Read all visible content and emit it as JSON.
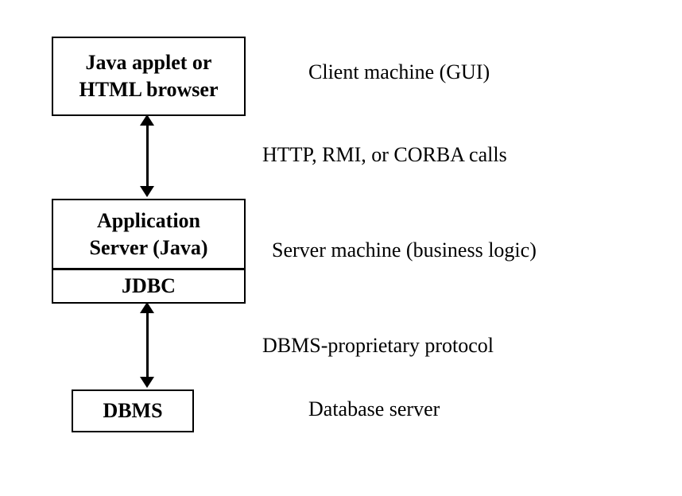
{
  "diagram": {
    "boxes": {
      "client": {
        "line1": "Java applet or",
        "line2": "HTML browser"
      },
      "appserver": {
        "line1": "Application",
        "line2": "Server (Java)",
        "jdbc": "JDBC"
      },
      "dbms": {
        "label": "DBMS"
      }
    },
    "labels": {
      "client_machine": "Client machine (GUI)",
      "http_calls": "HTTP, RMI, or CORBA calls",
      "server_machine": "Server machine (business logic)",
      "dbms_protocol": "DBMS-proprietary protocol",
      "db_server": "Database server"
    }
  }
}
